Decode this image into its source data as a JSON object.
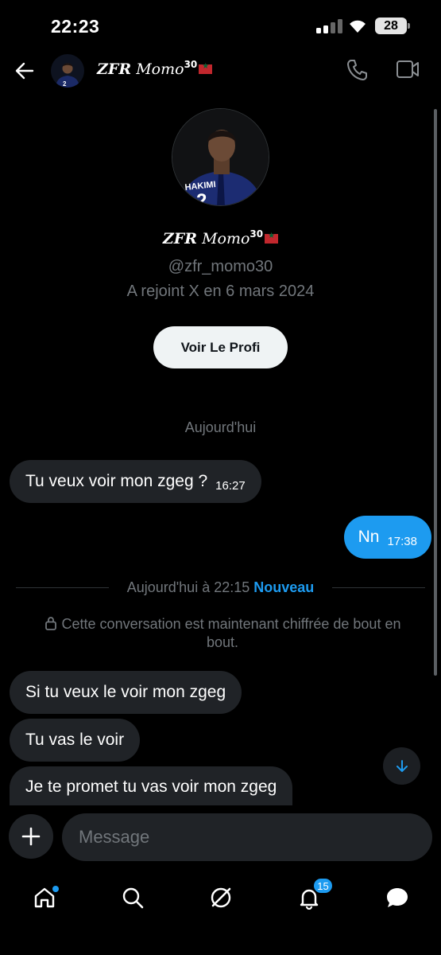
{
  "status_bar": {
    "time": "22:23",
    "battery": "28"
  },
  "header": {
    "name_bold": "ZFR",
    "name_italic": "Momo",
    "name_sup": "30"
  },
  "profile": {
    "name_bold": "ZFR",
    "name_italic": "Momo",
    "name_sup": "30",
    "handle": "@zfr_momo30",
    "joined": "A rejoint X en 6 mars 2024",
    "view_profile_label": "Voir Le Profi"
  },
  "date_separator": "Aujourd'hui",
  "messages_before": [
    {
      "direction": "incoming",
      "text": "Tu veux voir mon zgeg ?",
      "time": "16:27"
    },
    {
      "direction": "outgoing",
      "text": "Nn",
      "time": "17:38"
    }
  ],
  "new_separator": {
    "text": "Aujourd'hui à 22:15",
    "new_label": "Nouveau"
  },
  "encryption_note": "Cette conversation est maintenant chiffrée de bout en bout.",
  "messages_after": [
    {
      "direction": "incoming",
      "text": "Si tu veux le voir mon zgeg"
    },
    {
      "direction": "incoming",
      "text": "Tu vas le voir"
    },
    {
      "direction": "incoming",
      "text": "Je te promet tu vas voir mon zgeg"
    }
  ],
  "composer": {
    "placeholder": "Message"
  },
  "bottom_nav": {
    "items": [
      "home-icon",
      "search-icon",
      "grok-icon",
      "notifications-icon",
      "messages-icon"
    ],
    "notifications_count": "15"
  },
  "colors": {
    "accent": "#1d9bf0",
    "bubble_incoming": "#202327",
    "background": "#000000",
    "flag_red": "#c1272d",
    "flag_green": "#006233"
  }
}
